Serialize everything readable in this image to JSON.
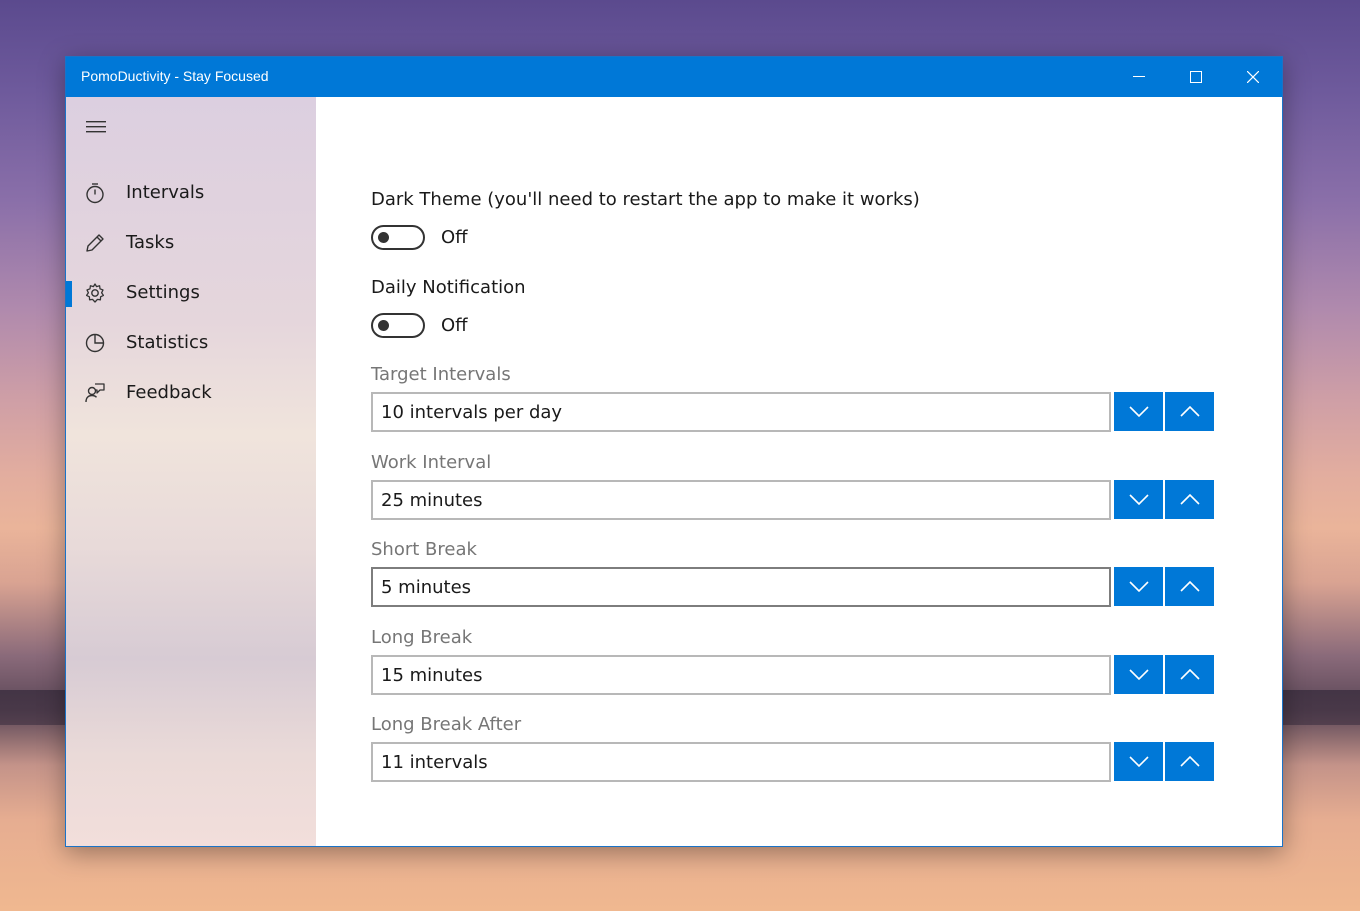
{
  "window": {
    "title": "PomoDuctivity - Stay Focused"
  },
  "sidebar": {
    "items": [
      {
        "label": "Intervals",
        "icon": "stopwatch-icon"
      },
      {
        "label": "Tasks",
        "icon": "pencil-icon"
      },
      {
        "label": "Settings",
        "icon": "gear-icon",
        "selected": true
      },
      {
        "label": "Statistics",
        "icon": "pie-chart-icon"
      },
      {
        "label": "Feedback",
        "icon": "feedback-icon"
      }
    ]
  },
  "settings": {
    "dark_theme": {
      "label": "Dark Theme (you'll need to restart the app to make it works)",
      "state": "Off"
    },
    "daily_notification": {
      "label": "Daily Notification",
      "state": "Off"
    },
    "target_intervals": {
      "label": "Target Intervals",
      "value": "10 intervals per day"
    },
    "work_interval": {
      "label": "Work Interval",
      "value": "25 minutes"
    },
    "short_break": {
      "label": "Short Break",
      "value": "5 minutes"
    },
    "long_break": {
      "label": "Long Break",
      "value": "15 minutes"
    },
    "long_break_after": {
      "label": "Long Break After",
      "value": "11 intervals"
    }
  },
  "colors": {
    "accent": "#0078d7",
    "label_gray": "#767676"
  }
}
